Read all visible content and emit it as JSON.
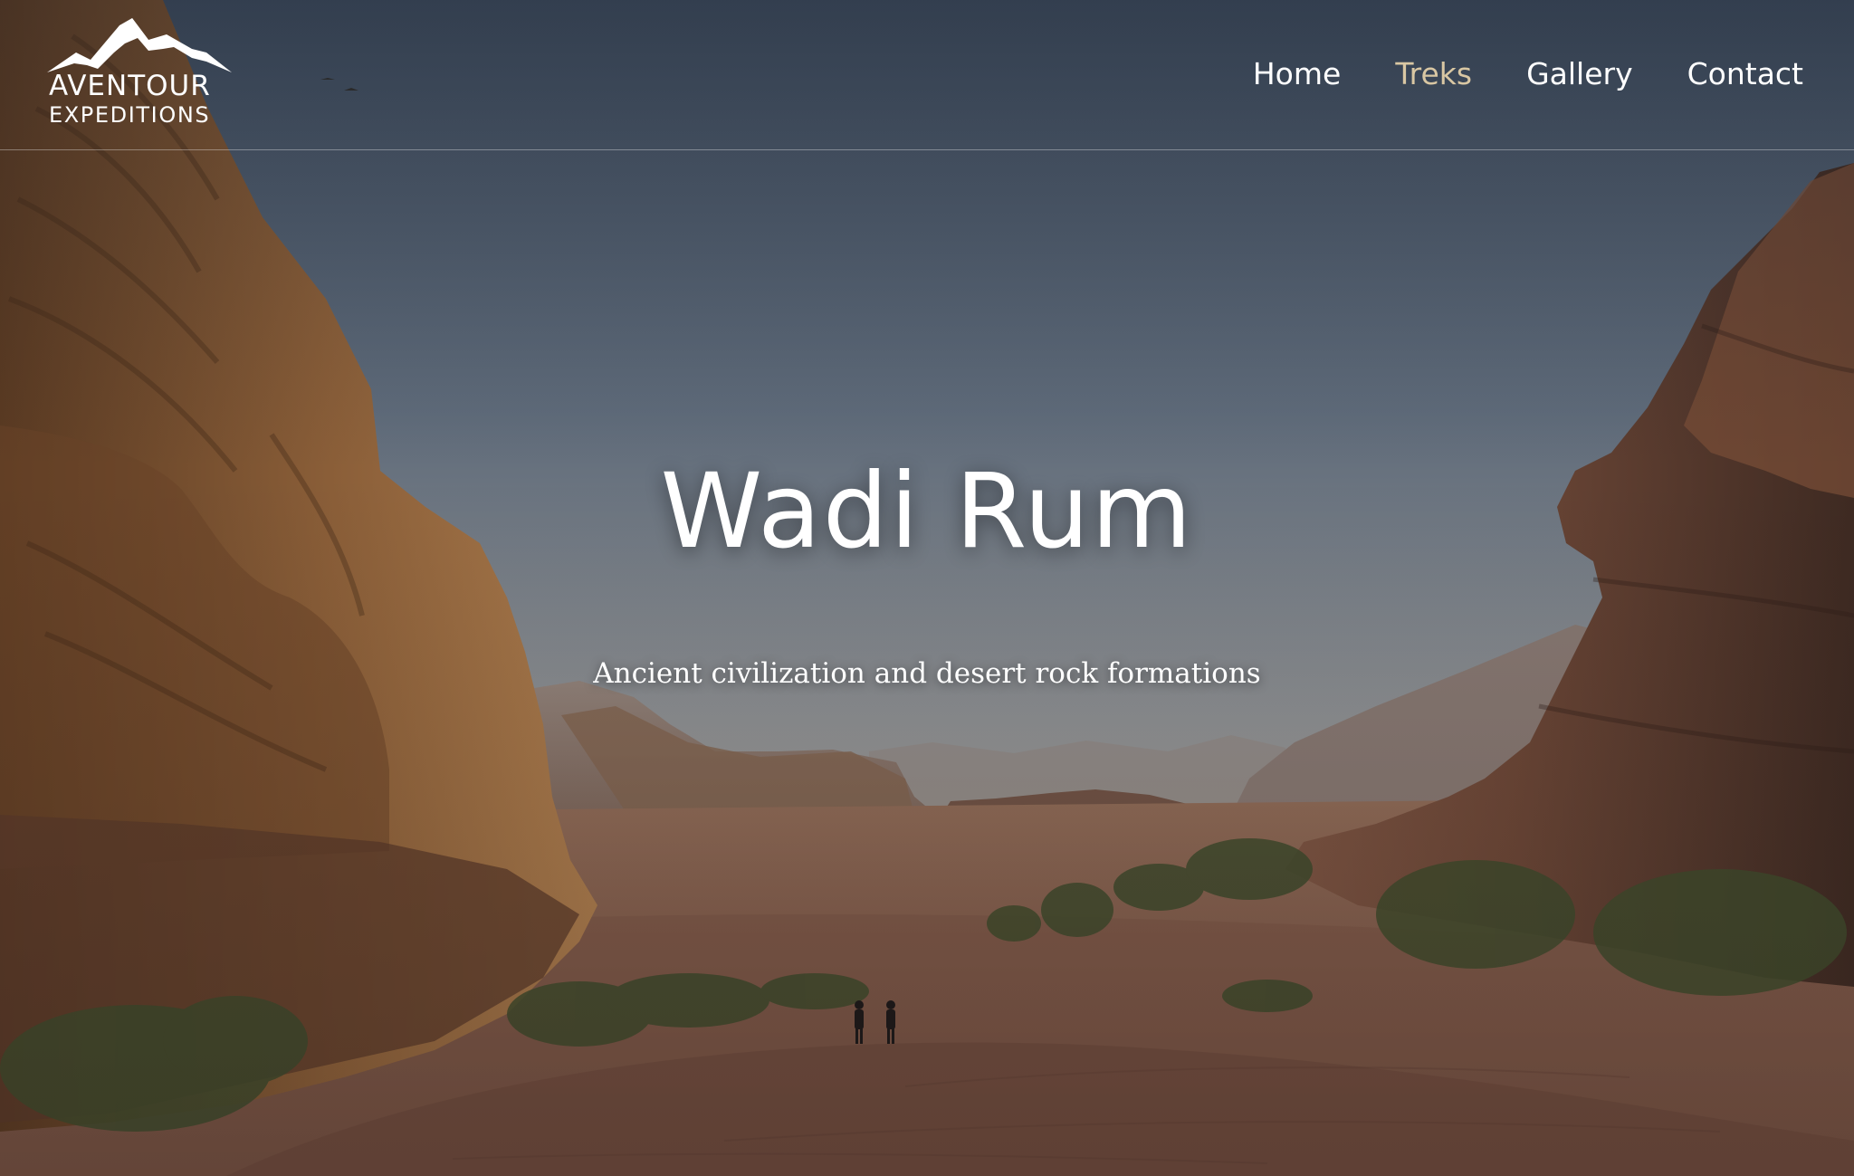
{
  "brand": {
    "name_line1": "AVENTOUR",
    "name_line2": "EXPEDITIONS",
    "logo_icon": "mountain-icon"
  },
  "nav": {
    "items": [
      {
        "label": "Home",
        "active": false
      },
      {
        "label": "Treks",
        "active": true
      },
      {
        "label": "Gallery",
        "active": false
      },
      {
        "label": "Contact",
        "active": false
      }
    ],
    "active_color": "#d9c7a3",
    "text_color": "#ffffff"
  },
  "hero": {
    "title": "Wadi Rum",
    "subtitle": "Ancient civilization and desert rock formations"
  }
}
